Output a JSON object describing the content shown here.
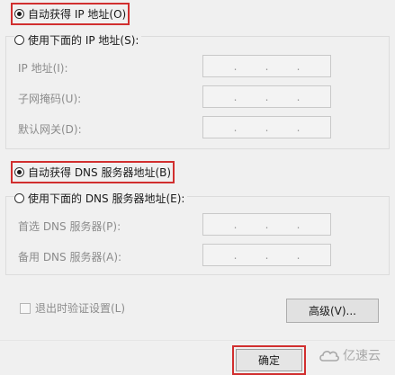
{
  "ip_section": {
    "auto_label": "自动获得 IP 地址(O)",
    "manual_label": "使用下面的 IP 地址(S):",
    "fields": [
      {
        "label": "IP 地址(I):",
        "value": ".     .     ."
      },
      {
        "label": "子网掩码(U):",
        "value": ".     .     ."
      },
      {
        "label": "默认网关(D):",
        "value": ".     .     ."
      }
    ]
  },
  "dns_section": {
    "auto_label": "自动获得 DNS 服务器地址(B)",
    "manual_label": "使用下面的 DNS 服务器地址(E):",
    "fields": [
      {
        "label": "首选 DNS 服务器(P):",
        "value": ".     .     ."
      },
      {
        "label": "备用 DNS 服务器(A):",
        "value": ".     .     ."
      }
    ]
  },
  "validate_checkbox": {
    "label": "退出时验证设置(L)"
  },
  "buttons": {
    "advanced": "高级(V)...",
    "ok": "确定"
  },
  "watermark": {
    "text": "亿速云"
  },
  "colors": {
    "highlight": "#d12f2f",
    "disabled_text": "#8c8c8c"
  }
}
